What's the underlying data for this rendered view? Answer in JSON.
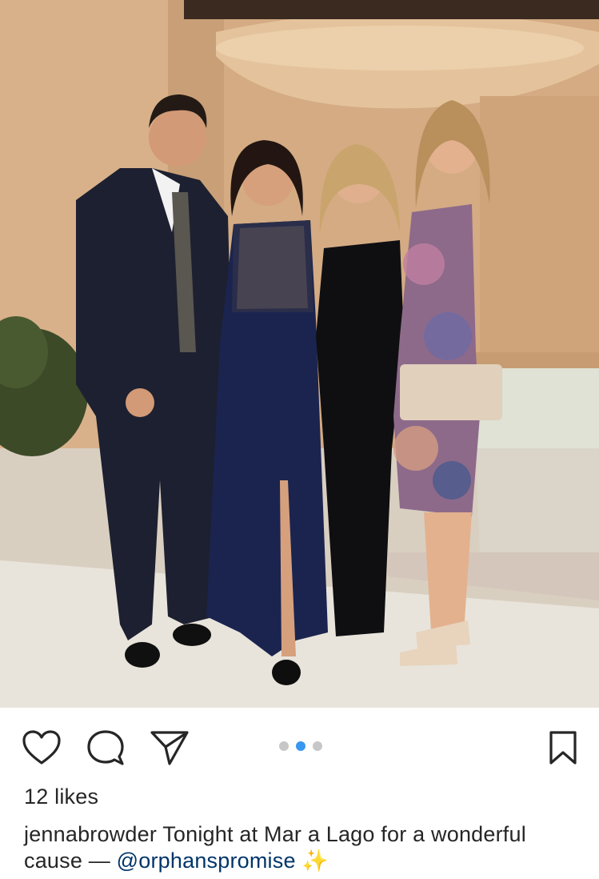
{
  "post": {
    "likes_text": "12 likes",
    "caption": {
      "username": "jennabrowder",
      "text_before_mention": " Tonight at Mar a Lago for a wonderful cause — ",
      "mention": "@orphanspromise",
      "emoji": " ✨"
    },
    "carousel": {
      "total": 3,
      "active_index": 1
    }
  },
  "icons": {
    "like": "heart-icon",
    "comment": "comment-bubble-icon",
    "share": "paper-plane-icon",
    "save": "bookmark-icon"
  },
  "colors": {
    "accent_dot": "#3897f0",
    "inactive_dot": "#c7c7c7",
    "mention": "#003569",
    "text": "#262626"
  }
}
